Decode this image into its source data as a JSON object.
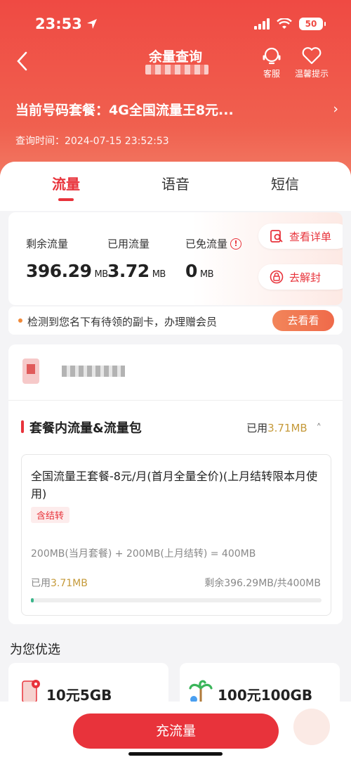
{
  "status": {
    "time": "23:53",
    "battery": "50"
  },
  "nav": {
    "title": "余量查询",
    "service_label": "客服",
    "tips_label": "温馨提示"
  },
  "plan": {
    "label": "当前号码套餐：",
    "name": "4G全国流量王8元...",
    "query_time": "查询时间：2024-07-15 23:52:53"
  },
  "tabs": [
    "流量",
    "语音",
    "短信"
  ],
  "usage": {
    "remaining_label": "剩余流量",
    "remaining_value": "396.29",
    "remaining_unit": "MB",
    "used_label": "已用流量",
    "used_value": "3.72",
    "used_unit": "MB",
    "free_label": "已免流量",
    "free_value": "0",
    "free_unit": "MB",
    "detail_button": "查看详单",
    "unseal_button": "去解封"
  },
  "notice": {
    "text": "检测到您名下有待领的副卡，办理赠会员",
    "button": "去看看"
  },
  "package_section": {
    "title": "套餐内流量&流量包",
    "used_prefix": "已用",
    "used_value": "3.71MB",
    "package_name": "全国流量王套餐-8元/月(首月全量全价)(上月结转限本月使用)",
    "tag": "含结转",
    "formula": "200MB(当月套餐) + 200MB(上月结转) = 400MB",
    "progress_used_prefix": "已用",
    "progress_used_value": "3.71MB",
    "progress_remaining": "剩余396.29MB/共400MB",
    "progress_fraction": 0.0093
  },
  "recommend": {
    "title": "为您优选",
    "offers": [
      "10元5GB",
      "100元100GB"
    ]
  },
  "bottom": {
    "recharge_button": "充流量"
  },
  "colors": {
    "accent": "#e8333b",
    "gold": "#c59a3a",
    "progress": "#3bb58a"
  }
}
